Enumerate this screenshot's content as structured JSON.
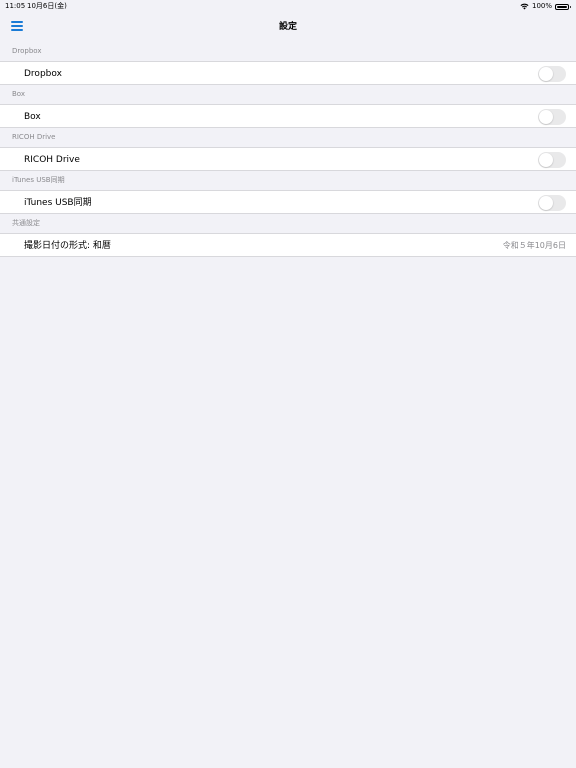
{
  "status_bar": {
    "time": "11:05",
    "date": "10月6日(金)",
    "battery": "100%"
  },
  "nav": {
    "title": "設定"
  },
  "sections": [
    {
      "header": "Dropbox",
      "label": "Dropbox",
      "toggle_on": false
    },
    {
      "header": "Box",
      "label": "Box",
      "toggle_on": false
    },
    {
      "header": "RICOH Drive",
      "label": "RICOH Drive",
      "toggle_on": false
    },
    {
      "header": "iTunes USB同期",
      "label": "iTunes USB同期",
      "toggle_on": false
    },
    {
      "header": "共通設定",
      "label": "撮影日付の形式: 和暦",
      "value": "令和５年10月6日"
    }
  ],
  "colors": {
    "accent": "#1a7bd6",
    "background": "#f2f2f7",
    "toggle_off": "#e9e9ea"
  }
}
